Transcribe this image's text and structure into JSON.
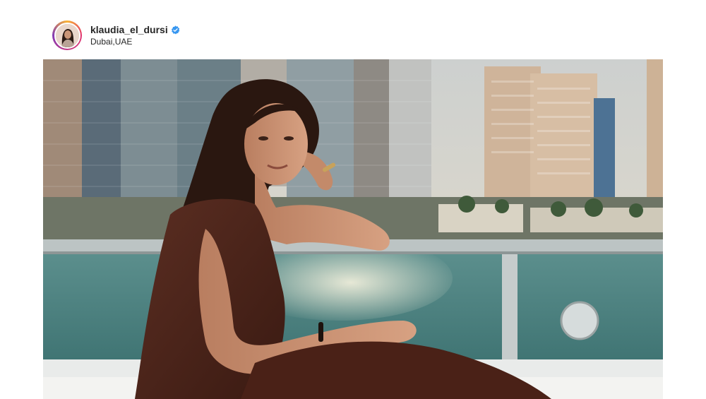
{
  "post": {
    "username": "klaudia_el_dursi",
    "location": "Dubai,UAE",
    "verified": true,
    "icons": {
      "verified": "verified-badge-icon"
    },
    "colors": {
      "verified_badge": "#3897f0",
      "username_text": "#262626"
    }
  }
}
